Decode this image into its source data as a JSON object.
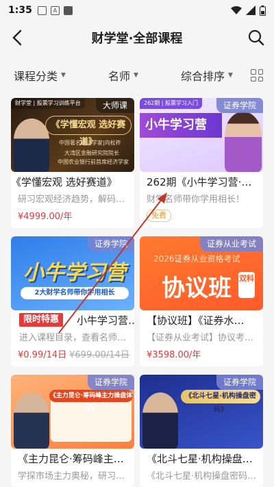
{
  "status": {
    "time": "1:35",
    "icon_a": "A"
  },
  "header": {
    "title": "财学堂·全部课程"
  },
  "filters": {
    "category": "课程分类",
    "teacher": "名师",
    "sort": "综合排序"
  },
  "cards": [
    {
      "title": "《学懂宏观 选好赛道》",
      "subtitle": "研习宏观经济趋势，解码…",
      "price": "¥4999.00/年",
      "badge": "大师课",
      "thumb_text": "《学懂宏观 选好赛道》",
      "lines": [
        "中国著名经济学家|向松祚",
        "大湾区金融研究院院长",
        "中国农业银行前首席经济学家"
      ],
      "brand": "财学堂 | 股票学习训练平台"
    },
    {
      "title": "262期《小牛学习营·…",
      "subtitle": "财学名师带你学用相长！",
      "badge": "证券学院",
      "free": "免费",
      "thumb_text": "小牛学习营",
      "thumb_top": "262期 | 股票学习入门"
    },
    {
      "title": "小牛学习营…",
      "subtitle": "进入课程目录，查看名师…",
      "price": "¥0.99/14日",
      "old_price": "¥699.00/14日",
      "promo": "限时特惠",
      "badge": "证券学院",
      "thumb_text": "小牛学习营",
      "strip": "2大财学名师带你学用相长"
    },
    {
      "title": "【协议班】《证券水…",
      "subtitle": "【证券从业考试】协议考…",
      "price": "¥3598.00/年",
      "badge": "证券从业考试",
      "thumb_top": "2026证券从业资格考试",
      "thumb_text": "协议班",
      "dual": "双科"
    },
    {
      "title": "《主力昆仑·筹码峰主…",
      "subtitle": "学探市场主力奥秘，研习…",
      "badge": "证券学院",
      "thumb_text": "《主力昆仑·筹码峰主力操盘体系》"
    },
    {
      "title": "《北斗七星·机构操盘…",
      "subtitle": "《北斗七星·机构操盘密码…",
      "badge": "证券学院",
      "thumb_text": "《北斗七星·机构操盘密码》"
    }
  ],
  "colors": {
    "price": "#e5393a",
    "accent": "#6b37d0",
    "annotation": "#c0392b"
  }
}
